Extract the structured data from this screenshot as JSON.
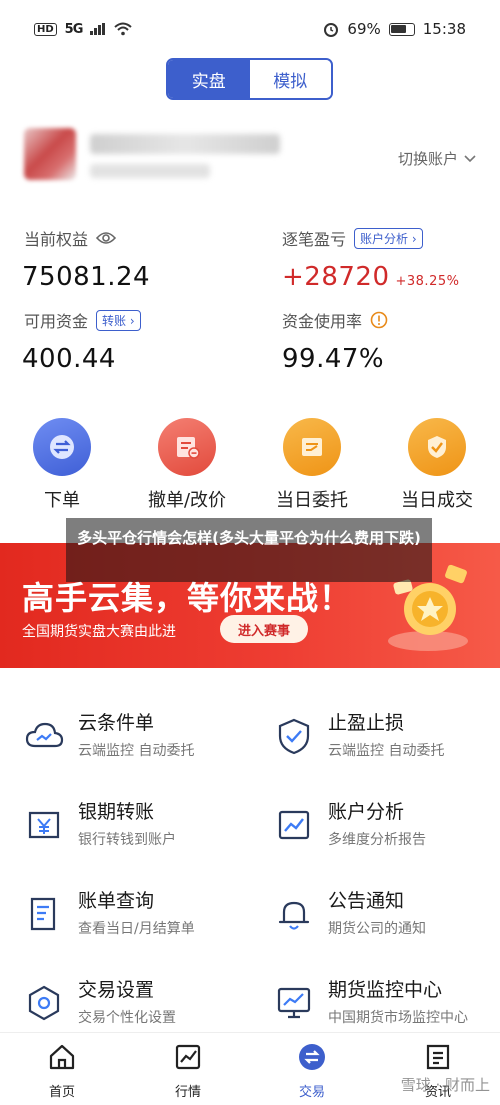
{
  "status": {
    "hd": "HD",
    "net": "5G",
    "battery": "69%",
    "battery_fraction": 0.69,
    "time": "15:38"
  },
  "tabs": [
    {
      "label": "实盘",
      "active": true
    },
    {
      "label": "模拟",
      "active": false
    }
  ],
  "account": {
    "switch_label": "切换账户"
  },
  "stats": {
    "equity_label": "当前权益",
    "equity_value": "75081.24",
    "pnl_label": "逐笔盈亏",
    "pnl_button": "账户分析",
    "pnl_value": "+28720",
    "pnl_pct": "+38.25%",
    "avail_label": "可用资金",
    "avail_button": "转账",
    "avail_value": "400.44",
    "usage_label": "资金使用率",
    "usage_value": "99.47%"
  },
  "actions": [
    {
      "label": "下单",
      "icon": "exchange-icon"
    },
    {
      "label": "撤单/改价",
      "icon": "cancel-order-icon"
    },
    {
      "label": "当日委托",
      "icon": "entrust-icon"
    },
    {
      "label": "当日成交",
      "icon": "deal-icon"
    }
  ],
  "overlay_caption": "多头平仓行情会怎样(多头大量平仓为什么费用下跌)",
  "banner": {
    "title": "高手云集，等你来战！",
    "subtitle": "全国期货实盘大赛由此进",
    "button": "进入赛事"
  },
  "menu": [
    {
      "title": "云条件单",
      "sub": "云端监控 自动委托",
      "icon": "cloud-icon"
    },
    {
      "title": "止盈止损",
      "sub": "云端监控 自动委托",
      "icon": "shield-check-icon"
    },
    {
      "title": "银期转账",
      "sub": "银行转钱到账户",
      "icon": "yuan-transfer-icon"
    },
    {
      "title": "账户分析",
      "sub": "多维度分析报告",
      "icon": "analysis-chart-icon"
    },
    {
      "title": "账单查询",
      "sub": "查看当日/月结算单",
      "icon": "bill-icon"
    },
    {
      "title": "公告通知",
      "sub": "期货公司的通知",
      "icon": "bell-icon"
    },
    {
      "title": "交易设置",
      "sub": "交易个性化设置",
      "icon": "settings-hex-icon"
    },
    {
      "title": "期货监控中心",
      "sub": "中国期货市场监控中心",
      "icon": "monitor-icon"
    }
  ],
  "nav": [
    {
      "label": "首页",
      "icon": "home-icon",
      "active": false
    },
    {
      "label": "行情",
      "icon": "market-icon",
      "active": false
    },
    {
      "label": "交易",
      "icon": "trade-icon",
      "active": true
    },
    {
      "label": "资讯",
      "icon": "news-icon",
      "active": false
    }
  ],
  "watermark": "雪球 · 财而上"
}
